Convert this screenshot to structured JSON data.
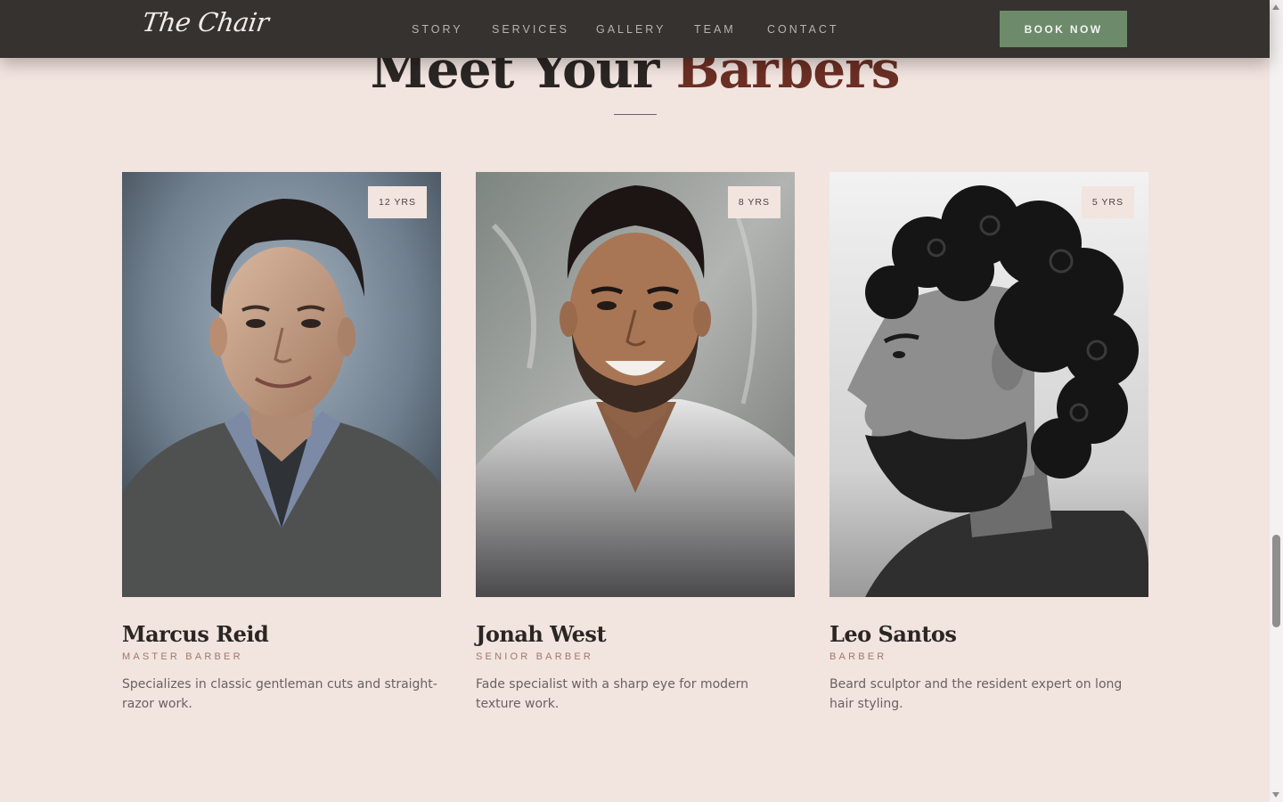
{
  "header": {
    "logo": "The Chair",
    "nav": [
      "STORY",
      "SERVICES",
      "GALLERY",
      "TEAM",
      "CONTACT"
    ],
    "cta": "BOOK NOW"
  },
  "section": {
    "title_main": "Meet Your ",
    "title_accent": "Barbers"
  },
  "barbers": [
    {
      "name": "Marcus Reid",
      "role": "MASTER BARBER",
      "years": "12 YRS",
      "bio": "Specializes in classic gentleman cuts and straight-razor work."
    },
    {
      "name": "Jonah West",
      "role": "SENIOR BARBER",
      "years": "8 YRS",
      "bio": "Fade specialist with a sharp eye for modern texture work."
    },
    {
      "name": "Leo Santos",
      "role": "BARBER",
      "years": "5 YRS",
      "bio": "Beard sculptor and the resident expert on long hair styling."
    }
  ],
  "colors": {
    "page_bg": "#f2e4df",
    "header_bg": "#363230",
    "cta_bg": "#6d8a6a",
    "accent": "#6b2f24",
    "role_text": "#a0786d"
  }
}
